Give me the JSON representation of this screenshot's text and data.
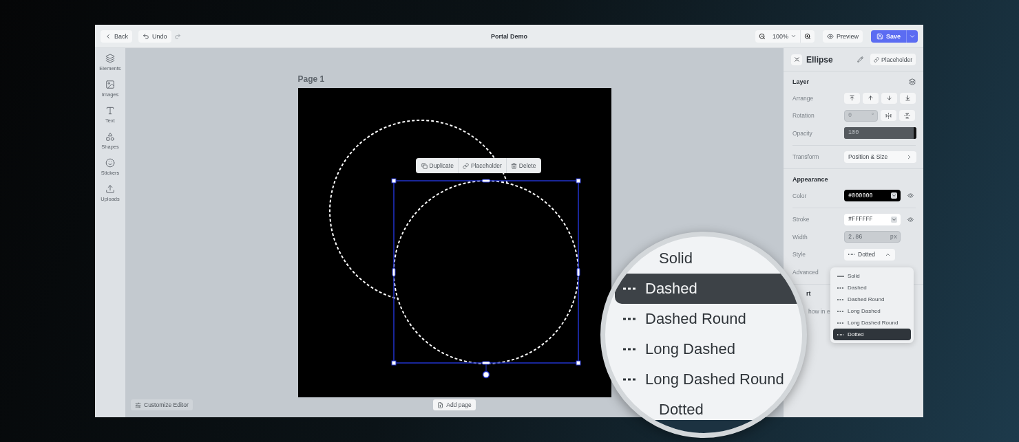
{
  "topbar": {
    "back": "Back",
    "undo": "Undo",
    "title": "Portal Demo",
    "zoom": "100%",
    "preview": "Preview",
    "save": "Save"
  },
  "sidebar": {
    "items": [
      {
        "label": "Elements"
      },
      {
        "label": "Images"
      },
      {
        "label": "Text"
      },
      {
        "label": "Shapes"
      },
      {
        "label": "Stickers"
      },
      {
        "label": "Uploads"
      }
    ]
  },
  "canvas": {
    "page_label": "Page 1",
    "toolbar": [
      "Duplicate",
      "Placeholder",
      "Delete"
    ],
    "customize": "Customize Editor",
    "add_page": "Add page"
  },
  "panel": {
    "title": "Ellipse",
    "placeholder_button": "Placeholder",
    "layer": {
      "heading": "Layer",
      "arrange": "Arrange",
      "rotation": {
        "label": "Rotation",
        "value": "0",
        "unit": "°"
      },
      "opacity": {
        "label": "Opacity",
        "value": "100",
        "level": 1
      },
      "transform": {
        "label": "Transform",
        "value": "Position & Size"
      }
    },
    "appearance": {
      "heading": "Appearance",
      "color": {
        "label": "Color",
        "value": "#000000"
      },
      "stroke": {
        "label": "Stroke",
        "value": "#FFFFFF"
      },
      "width": {
        "label": "Width",
        "value": "2.86",
        "unit": "px"
      },
      "style": {
        "label": "Style",
        "value": "Dotted",
        "kind": "dotted"
      },
      "advanced": "Advanced"
    },
    "section_3": {
      "heading": "rt",
      "row_label": "how in e"
    }
  },
  "style_menu": {
    "open": true,
    "items": [
      {
        "label": "Solid",
        "kind": "solid",
        "selected": false
      },
      {
        "label": "Dashed",
        "kind": "dashed",
        "selected": false
      },
      {
        "label": "Dashed Round",
        "kind": "dashed",
        "selected": false
      },
      {
        "label": "Long Dashed",
        "kind": "dashed",
        "selected": false
      },
      {
        "label": "Long Dashed Round",
        "kind": "dashed",
        "selected": false
      },
      {
        "label": "Dotted",
        "kind": "dotted",
        "selected": true
      }
    ]
  },
  "magnifier": {
    "items": [
      {
        "label": "Solid",
        "kind": "none",
        "selected": false
      },
      {
        "label": "Dashed",
        "kind": "dashed",
        "selected": true
      },
      {
        "label": "Dashed Round",
        "kind": "dashed",
        "selected": false
      },
      {
        "label": "Long Dashed",
        "kind": "dashed",
        "selected": false
      },
      {
        "label": "Long Dashed Round",
        "kind": "dashed",
        "selected": false
      },
      {
        "label": "Dotted",
        "kind": "none",
        "selected": false
      }
    ]
  }
}
